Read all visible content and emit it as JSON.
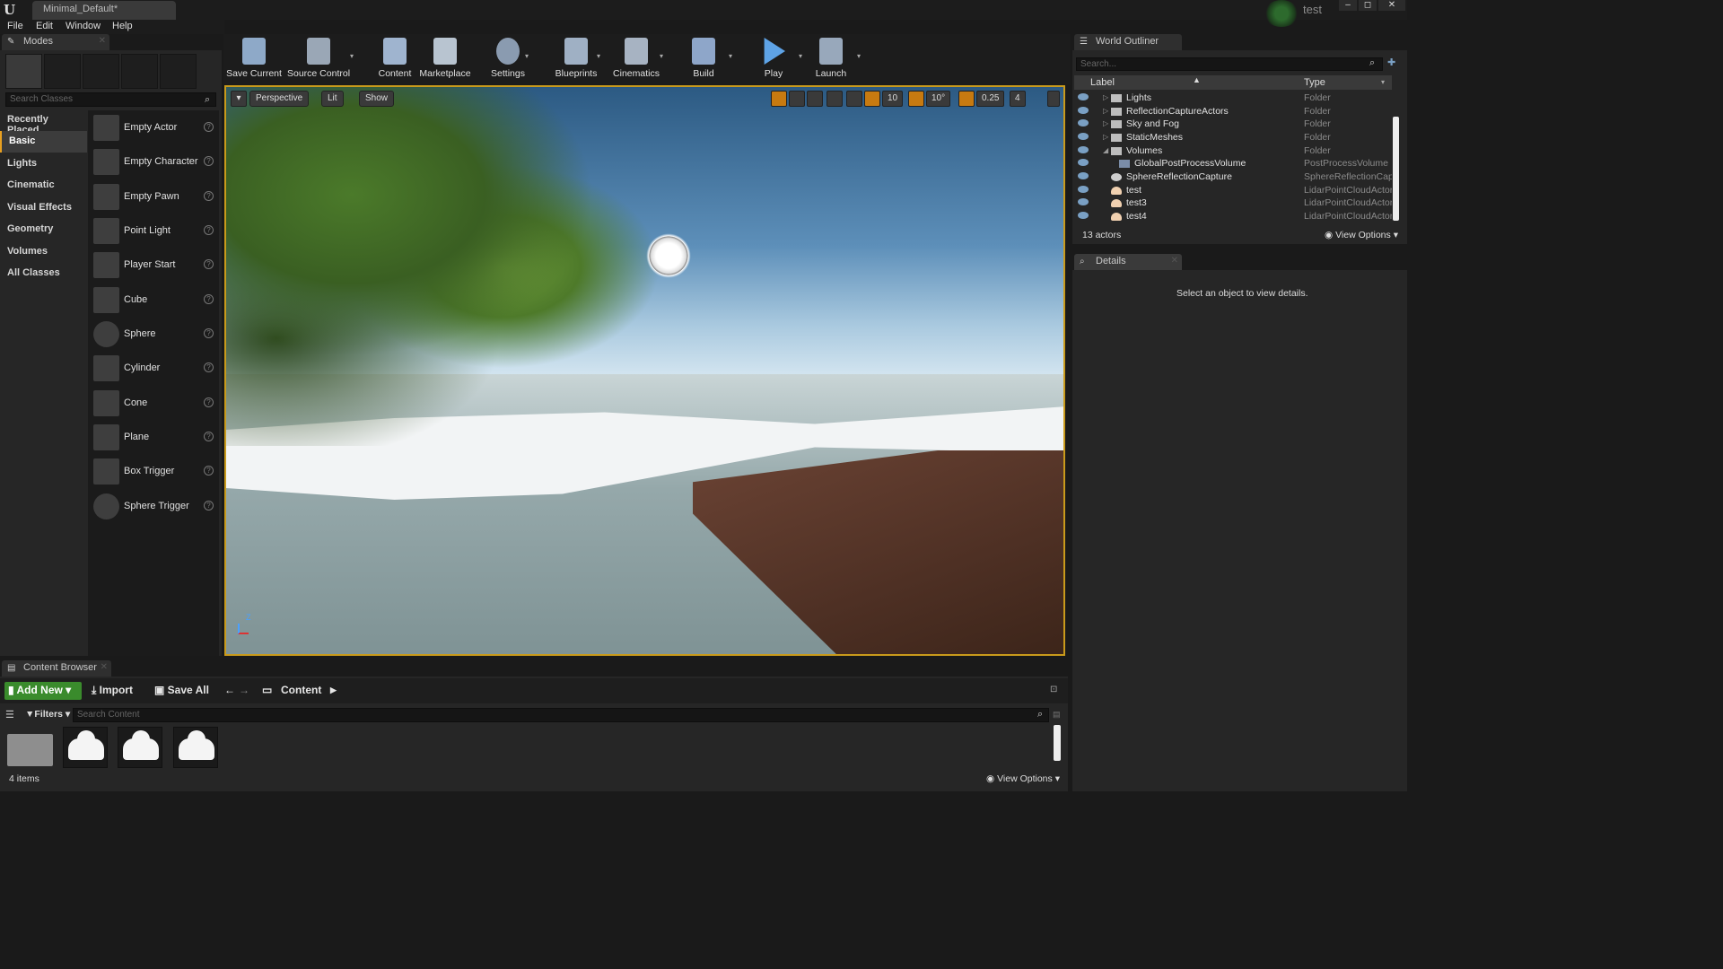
{
  "window": {
    "tab_title": "Minimal_Default*",
    "project_name": "test",
    "logo": "U",
    "minimize": "–",
    "maximize": "◻",
    "close": "✕"
  },
  "menu": {
    "file": "File",
    "edit": "Edit",
    "window": "Window",
    "help": "Help"
  },
  "modes": {
    "tab_label": "Modes",
    "search_placeholder": "Search Classes",
    "categories": [
      "Recently Placed",
      "Basic",
      "Lights",
      "Cinematic",
      "Visual Effects",
      "Geometry",
      "Volumes",
      "All Classes"
    ],
    "items": [
      "Empty Actor",
      "Empty Character",
      "Empty Pawn",
      "Point Light",
      "Player Start",
      "Cube",
      "Sphere",
      "Cylinder",
      "Cone",
      "Plane",
      "Box Trigger",
      "Sphere Trigger"
    ],
    "help_glyph": "?"
  },
  "toolbar": {
    "items": [
      "Save Current",
      "Source Control",
      "Content",
      "Marketplace",
      "Settings",
      "Blueprints",
      "Cinematics",
      "Build",
      "Play",
      "Launch"
    ],
    "dropdown": "▾"
  },
  "viewport": {
    "menu_glyph": "▾",
    "perspective": "Perspective",
    "lit": "Lit",
    "show": "Show",
    "grid_snap": "10",
    "rot_snap": "10°",
    "scale_snap": "0.25",
    "cam_speed": "4",
    "axis_z": "Z"
  },
  "outliner": {
    "tab_label": "World Outliner",
    "search_placeholder": "Search...",
    "col_label": "Label",
    "col_type": "Type",
    "rows": [
      {
        "label": "Lights",
        "type": "Folder"
      },
      {
        "label": "ReflectionCaptureActors",
        "type": "Folder"
      },
      {
        "label": "Sky and Fog",
        "type": "Folder"
      },
      {
        "label": "StaticMeshes",
        "type": "Folder"
      },
      {
        "label": "Volumes",
        "type": "Folder"
      },
      {
        "label": "GlobalPostProcessVolume",
        "type": "PostProcessVolume"
      },
      {
        "label": "SphereReflectionCapture",
        "type": "SphereReflectionCapt"
      },
      {
        "label": "test",
        "type": "LidarPointCloudActor"
      },
      {
        "label": "test3",
        "type": "LidarPointCloudActor"
      },
      {
        "label": "test4",
        "type": "LidarPointCloudActor"
      }
    ],
    "actor_count": "13 actors",
    "view_options": "View Options"
  },
  "details": {
    "tab_label": "Details",
    "empty_message": "Select an object to view details."
  },
  "content_browser": {
    "tab_label": "Content Browser",
    "add_new": "Add New",
    "import": "Import",
    "save_all": "Save All",
    "path": "Content",
    "filters": "Filters",
    "search_placeholder": "Search Content",
    "item_count": "4 items",
    "view_options": "View Options"
  },
  "colors": {
    "accent": "#c99a1b",
    "add_new_green": "#3a8b2c",
    "panel_bg": "#262626"
  }
}
